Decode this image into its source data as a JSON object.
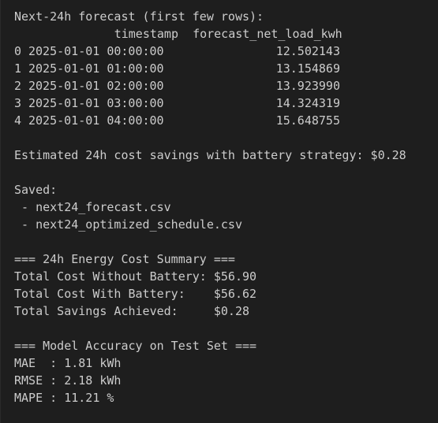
{
  "forecast_header": "Next-24h forecast (first few rows):",
  "table": {
    "columns": [
      "timestamp",
      "forecast_net_load_kwh"
    ],
    "rows": [
      {
        "index": "0",
        "timestamp": "2025-01-01 00:00:00",
        "value": "12.502143"
      },
      {
        "index": "1",
        "timestamp": "2025-01-01 01:00:00",
        "value": "13.154869"
      },
      {
        "index": "2",
        "timestamp": "2025-01-01 02:00:00",
        "value": "13.923990"
      },
      {
        "index": "3",
        "timestamp": "2025-01-01 03:00:00",
        "value": "14.324319"
      },
      {
        "index": "4",
        "timestamp": "2025-01-01 04:00:00",
        "value": "15.648755"
      }
    ]
  },
  "estimated_savings": "Estimated 24h cost savings with battery strategy: $0.28",
  "saved": {
    "label": "Saved:",
    "files": [
      " - next24_forecast.csv",
      " - next24_optimized_schedule.csv"
    ]
  },
  "cost_summary": {
    "title": "=== 24h Energy Cost Summary ===",
    "lines": [
      "Total Cost Without Battery: $56.90",
      "Total Cost With Battery:    $56.62",
      "Total Savings Achieved:     $0.28"
    ]
  },
  "accuracy": {
    "title": "=== Model Accuracy on Test Set ===",
    "lines": [
      "MAE  : 1.81 kWh",
      "RMSE : 2.18 kWh",
      "MAPE : 11.21 %"
    ]
  }
}
